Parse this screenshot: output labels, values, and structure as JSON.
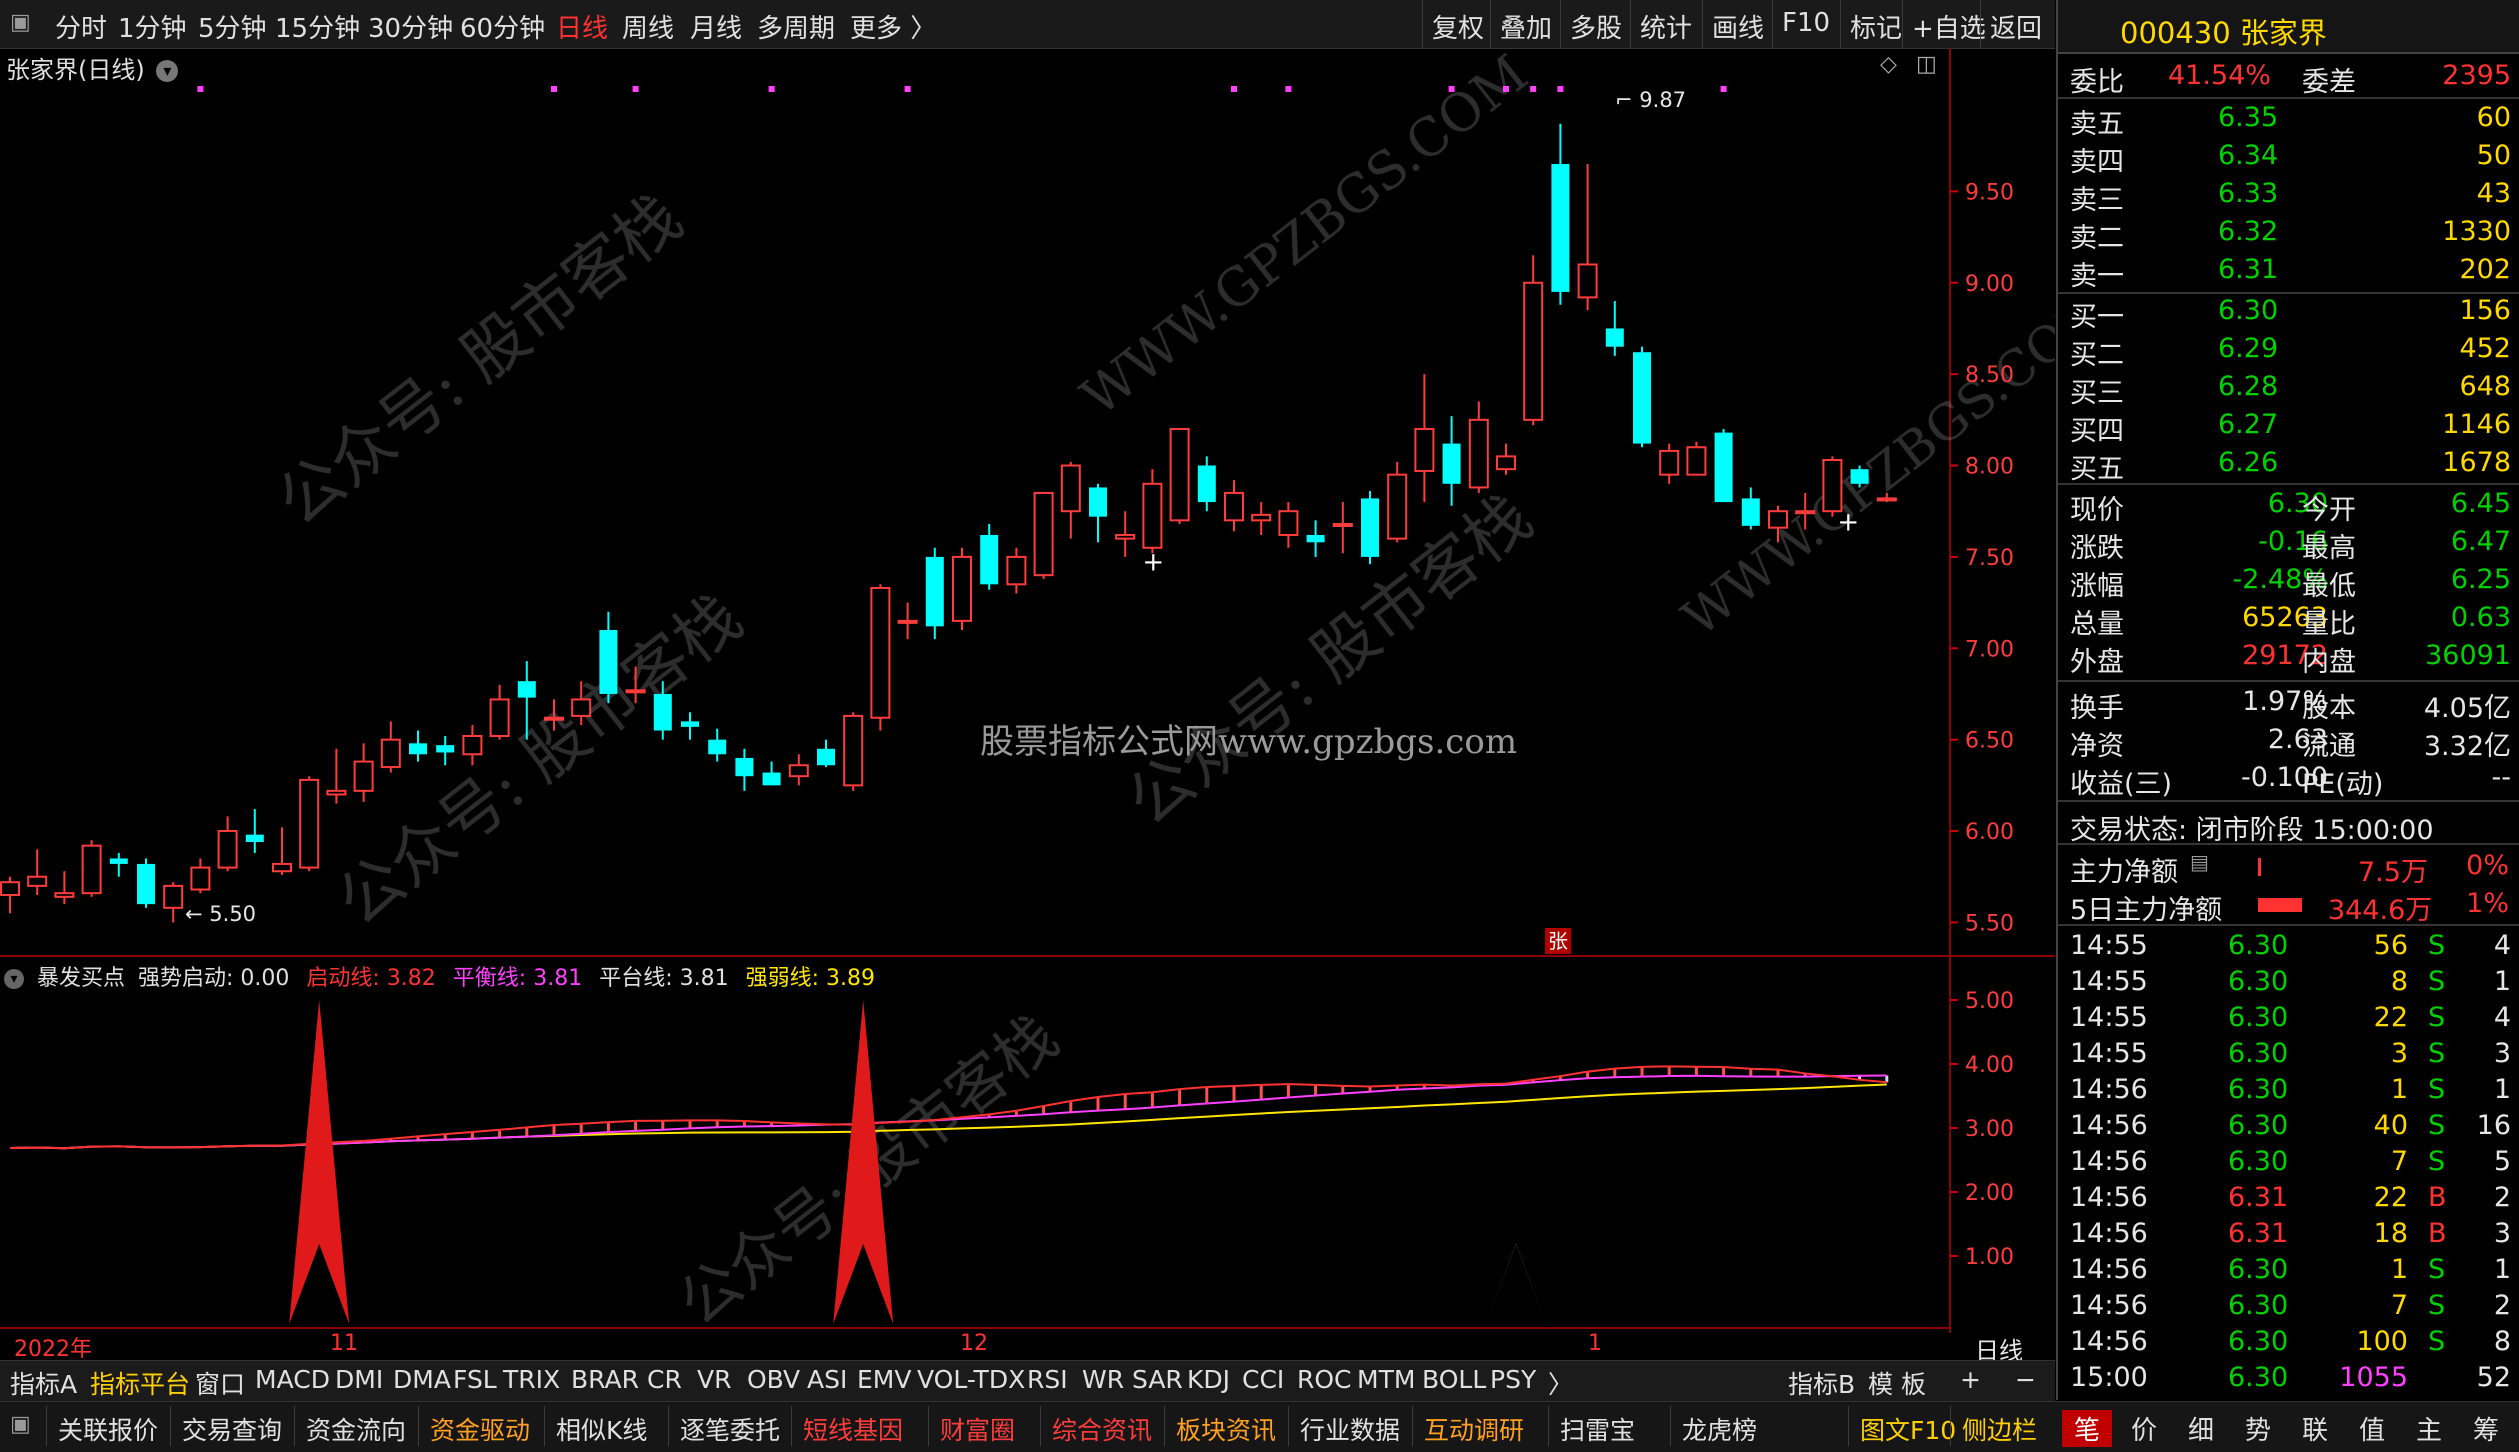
{
  "toolbar": {
    "periods": [
      "分时",
      "1分钟",
      "5分钟",
      "15分钟",
      "30分钟",
      "60分钟",
      "日线",
      "周线",
      "月线",
      "多周期",
      "更多 〉"
    ],
    "active_period": "日线",
    "right_buttons": [
      "复权",
      "叠加",
      "多股",
      "统计",
      "画线",
      "F10",
      "标记",
      "+自选",
      "返回"
    ]
  },
  "chart": {
    "title": "张家界(日线)",
    "high_label": "9.87",
    "low_label": "5.50",
    "zhang_label": "张",
    "watermark": "股票指标公式网www.gpzbgs.com",
    "price_axis": [
      "9.50",
      "9.00",
      "8.50",
      "8.00",
      "7.50",
      "7.00",
      "6.50",
      "6.00",
      "5.50"
    ],
    "ind_axis": [
      "5.00",
      "4.00",
      "3.00",
      "2.00",
      "1.00"
    ],
    "date_labels": [
      "2022年",
      "11",
      "12",
      "1"
    ],
    "period_label": "日线",
    "indicator": {
      "name": "暴发买点",
      "strong_label": "强势启动: 0.00",
      "start_label": "启动线: 3.82",
      "balance_label": "平衡线: 3.81",
      "platform_label": "平台线: 3.81",
      "weak_label": "强弱线: 3.89"
    }
  },
  "chart_data": {
    "type": "candlestick",
    "y_range": [
      5.36,
      10.0
    ],
    "candles": [
      {
        "o": 5.65,
        "h": 5.75,
        "l": 5.55,
        "c": 5.72
      },
      {
        "o": 5.7,
        "h": 5.9,
        "l": 5.65,
        "c": 5.75
      },
      {
        "o": 5.64,
        "h": 5.78,
        "l": 5.6,
        "c": 5.66
      },
      {
        "o": 5.66,
        "h": 5.95,
        "l": 5.64,
        "c": 5.92
      },
      {
        "o": 5.85,
        "h": 5.88,
        "l": 5.75,
        "c": 5.82
      },
      {
        "o": 5.82,
        "h": 5.85,
        "l": 5.58,
        "c": 5.6
      },
      {
        "o": 5.58,
        "h": 5.72,
        "l": 5.5,
        "c": 5.7
      },
      {
        "o": 5.68,
        "h": 5.85,
        "l": 5.66,
        "c": 5.8
      },
      {
        "o": 5.8,
        "h": 6.08,
        "l": 5.78,
        "c": 6.0
      },
      {
        "o": 5.98,
        "h": 6.12,
        "l": 5.88,
        "c": 5.94
      },
      {
        "o": 5.78,
        "h": 6.02,
        "l": 5.76,
        "c": 5.82
      },
      {
        "o": 5.8,
        "h": 6.3,
        "l": 5.78,
        "c": 6.28
      },
      {
        "o": 6.2,
        "h": 6.45,
        "l": 6.15,
        "c": 6.22
      },
      {
        "o": 6.22,
        "h": 6.48,
        "l": 6.16,
        "c": 6.38
      },
      {
        "o": 6.35,
        "h": 6.6,
        "l": 6.32,
        "c": 6.5
      },
      {
        "o": 6.48,
        "h": 6.55,
        "l": 6.38,
        "c": 6.42
      },
      {
        "o": 6.47,
        "h": 6.52,
        "l": 6.36,
        "c": 6.43
      },
      {
        "o": 6.42,
        "h": 6.58,
        "l": 6.36,
        "c": 6.52
      },
      {
        "o": 6.52,
        "h": 6.8,
        "l": 6.5,
        "c": 6.72
      },
      {
        "o": 6.82,
        "h": 6.93,
        "l": 6.5,
        "c": 6.73
      },
      {
        "o": 6.62,
        "h": 6.72,
        "l": 6.55,
        "c": 6.62
      },
      {
        "o": 6.63,
        "h": 6.82,
        "l": 6.58,
        "c": 6.72
      },
      {
        "o": 7.1,
        "h": 7.2,
        "l": 6.7,
        "c": 6.75
      },
      {
        "o": 6.77,
        "h": 6.9,
        "l": 6.7,
        "c": 6.77
      },
      {
        "o": 6.75,
        "h": 6.82,
        "l": 6.5,
        "c": 6.55
      },
      {
        "o": 6.6,
        "h": 6.65,
        "l": 6.5,
        "c": 6.57
      },
      {
        "o": 6.5,
        "h": 6.56,
        "l": 6.38,
        "c": 6.42
      },
      {
        "o": 6.4,
        "h": 6.45,
        "l": 6.22,
        "c": 6.3
      },
      {
        "o": 6.32,
        "h": 6.38,
        "l": 6.25,
        "c": 6.25
      },
      {
        "o": 6.3,
        "h": 6.42,
        "l": 6.25,
        "c": 6.36
      },
      {
        "o": 6.45,
        "h": 6.5,
        "l": 6.35,
        "c": 6.36
      },
      {
        "o": 6.25,
        "h": 6.65,
        "l": 6.22,
        "c": 6.63
      },
      {
        "o": 6.62,
        "h": 7.35,
        "l": 6.55,
        "c": 7.33
      },
      {
        "o": 7.15,
        "h": 7.25,
        "l": 7.05,
        "c": 7.15
      },
      {
        "o": 7.5,
        "h": 7.55,
        "l": 7.05,
        "c": 7.12
      },
      {
        "o": 7.15,
        "h": 7.55,
        "l": 7.1,
        "c": 7.5
      },
      {
        "o": 7.62,
        "h": 7.68,
        "l": 7.32,
        "c": 7.35
      },
      {
        "o": 7.35,
        "h": 7.55,
        "l": 7.3,
        "c": 7.5
      },
      {
        "o": 7.4,
        "h": 7.85,
        "l": 7.38,
        "c": 7.85
      },
      {
        "o": 7.75,
        "h": 8.02,
        "l": 7.6,
        "c": 8.0
      },
      {
        "o": 7.88,
        "h": 7.9,
        "l": 7.58,
        "c": 7.72
      },
      {
        "o": 7.6,
        "h": 7.75,
        "l": 7.5,
        "c": 7.62
      },
      {
        "o": 7.55,
        "h": 7.98,
        "l": 7.52,
        "c": 7.9
      },
      {
        "o": 7.7,
        "h": 8.2,
        "l": 7.68,
        "c": 8.2
      },
      {
        "o": 8.0,
        "h": 8.05,
        "l": 7.75,
        "c": 7.8
      },
      {
        "o": 7.7,
        "h": 7.92,
        "l": 7.64,
        "c": 7.85
      },
      {
        "o": 7.7,
        "h": 7.8,
        "l": 7.62,
        "c": 7.73
      },
      {
        "o": 7.62,
        "h": 7.8,
        "l": 7.55,
        "c": 7.75
      },
      {
        "o": 7.62,
        "h": 7.7,
        "l": 7.5,
        "c": 7.58
      },
      {
        "o": 7.68,
        "h": 7.8,
        "l": 7.52,
        "c": 7.68
      },
      {
        "o": 7.82,
        "h": 7.86,
        "l": 7.46,
        "c": 7.5
      },
      {
        "o": 7.6,
        "h": 8.02,
        "l": 7.58,
        "c": 7.95
      },
      {
        "o": 7.97,
        "h": 8.5,
        "l": 7.8,
        "c": 8.2
      },
      {
        "o": 8.12,
        "h": 8.27,
        "l": 7.78,
        "c": 7.9
      },
      {
        "o": 7.88,
        "h": 8.35,
        "l": 7.85,
        "c": 8.25
      },
      {
        "o": 7.98,
        "h": 8.12,
        "l": 7.95,
        "c": 8.05
      },
      {
        "o": 8.25,
        "h": 9.15,
        "l": 8.22,
        "c": 9.0
      },
      {
        "o": 9.65,
        "h": 9.87,
        "l": 8.88,
        "c": 8.95
      },
      {
        "o": 8.92,
        "h": 9.65,
        "l": 8.85,
        "c": 9.1
      },
      {
        "o": 8.75,
        "h": 8.9,
        "l": 8.6,
        "c": 8.65
      },
      {
        "o": 8.62,
        "h": 8.65,
        "l": 8.1,
        "c": 8.12
      },
      {
        "o": 7.95,
        "h": 8.12,
        "l": 7.9,
        "c": 8.08
      },
      {
        "o": 7.95,
        "h": 8.13,
        "l": 7.95,
        "c": 8.1
      },
      {
        "o": 8.18,
        "h": 8.2,
        "l": 7.8,
        "c": 7.8
      },
      {
        "o": 7.82,
        "h": 7.88,
        "l": 7.65,
        "c": 7.67
      },
      {
        "o": 7.66,
        "h": 7.78,
        "l": 7.58,
        "c": 7.75
      },
      {
        "o": 7.75,
        "h": 7.85,
        "l": 7.65,
        "c": 7.75
      },
      {
        "o": 7.75,
        "h": 8.05,
        "l": 7.72,
        "c": 8.03
      },
      {
        "o": 7.98,
        "h": 8.0,
        "l": 7.88,
        "c": 7.9
      },
      {
        "o": 7.82,
        "h": 7.85,
        "l": 7.8,
        "c": 7.82
      }
    ],
    "start_spikes": [
      {
        "i": 11,
        "v": 5.0,
        "color": "red"
      },
      {
        "i": 31,
        "v": 5.0,
        "color": "red"
      },
      {
        "i": 55,
        "v": 1.2,
        "color": "gray"
      }
    ],
    "ind_range": [
      0.0,
      5.5
    ]
  },
  "panel": {
    "header": "000430 张家界",
    "weibi_label": "委比",
    "weibi_value": "41.54%",
    "weicha_label": "委差",
    "weicha_value": "2395",
    "asks": [
      {
        "label": "卖五",
        "price": "6.35",
        "vol": "60"
      },
      {
        "label": "卖四",
        "price": "6.34",
        "vol": "50"
      },
      {
        "label": "卖三",
        "price": "6.33",
        "vol": "43"
      },
      {
        "label": "卖二",
        "price": "6.32",
        "vol": "1330"
      },
      {
        "label": "卖一",
        "price": "6.31",
        "vol": "202"
      }
    ],
    "bids": [
      {
        "label": "买一",
        "price": "6.30",
        "vol": "156"
      },
      {
        "label": "买二",
        "price": "6.29",
        "vol": "452"
      },
      {
        "label": "买三",
        "price": "6.28",
        "vol": "648"
      },
      {
        "label": "买四",
        "price": "6.27",
        "vol": "1146"
      },
      {
        "label": "买五",
        "price": "6.26",
        "vol": "1678"
      }
    ],
    "quote": [
      {
        "l1": "现价",
        "v1": "6.30",
        "c1": "green",
        "l2": "今开",
        "v2": "6.45",
        "c2": "green"
      },
      {
        "l1": "涨跌",
        "v1": "-0.16",
        "c1": "green",
        "l2": "最高",
        "v2": "6.47",
        "c2": "green"
      },
      {
        "l1": "涨幅",
        "v1": "-2.48%",
        "c1": "green",
        "l2": "最低",
        "v2": "6.25",
        "c2": "green"
      },
      {
        "l1": "总量",
        "v1": "65263",
        "c1": "yellow",
        "l2": "量比",
        "v2": "0.63",
        "c2": "green"
      },
      {
        "l1": "外盘",
        "v1": "29172",
        "c1": "red",
        "l2": "内盘",
        "v2": "36091",
        "c2": "green"
      }
    ],
    "fund": [
      {
        "l1": "换手",
        "v1": "1.97%",
        "l2": "股本",
        "v2": "4.05亿"
      },
      {
        "l1": "净资",
        "v1": "2.63",
        "l2": "流通",
        "v2": "3.32亿"
      },
      {
        "l1": "收益(三)",
        "v1": "-0.100",
        "l2": "PE(动)",
        "v2": "--"
      }
    ],
    "status": "交易状态: 闭市阶段 15:00:00",
    "main_net_label": "主力净额",
    "main_net_value": "7.5万",
    "main_net_pct": "0%",
    "main5_label": "5日主力净额",
    "main5_value": "344.6万",
    "main5_pct": "1%",
    "trades": [
      {
        "t": "14:55",
        "p": "6.30",
        "v": "56",
        "bs": "S",
        "n": "4"
      },
      {
        "t": "14:55",
        "p": "6.30",
        "v": "8",
        "bs": "S",
        "n": "1"
      },
      {
        "t": "14:55",
        "p": "6.30",
        "v": "22",
        "bs": "S",
        "n": "4"
      },
      {
        "t": "14:55",
        "p": "6.30",
        "v": "3",
        "bs": "S",
        "n": "3"
      },
      {
        "t": "14:56",
        "p": "6.30",
        "v": "1",
        "bs": "S",
        "n": "1"
      },
      {
        "t": "14:56",
        "p": "6.30",
        "v": "40",
        "bs": "S",
        "n": "16"
      },
      {
        "t": "14:56",
        "p": "6.30",
        "v": "7",
        "bs": "S",
        "n": "5"
      },
      {
        "t": "14:56",
        "p": "6.31",
        "v": "22",
        "bs": "B",
        "n": "2"
      },
      {
        "t": "14:56",
        "p": "6.31",
        "v": "18",
        "bs": "B",
        "n": "3"
      },
      {
        "t": "14:56",
        "p": "6.30",
        "v": "1",
        "bs": "S",
        "n": "1"
      },
      {
        "t": "14:56",
        "p": "6.30",
        "v": "7",
        "bs": "S",
        "n": "2"
      },
      {
        "t": "14:56",
        "p": "6.30",
        "v": "100",
        "bs": "S",
        "n": "8"
      },
      {
        "t": "15:00",
        "p": "6.30",
        "v": "1055",
        "bs": "",
        "n": "52"
      }
    ],
    "bottom_tabs": [
      "笔",
      "价",
      "细",
      "势",
      "联",
      "值",
      "主",
      "筹"
    ]
  },
  "indicator_tabs": [
    "指标A",
    "指标平台",
    "窗口",
    "MACD",
    "DMI",
    "DMA",
    "FSL",
    "TRIX",
    "BRAR",
    "CR",
    "VR",
    "OBV",
    "ASI",
    "EMV",
    "VOL-TDX",
    "RSI",
    "WR",
    "SAR",
    "KDJ",
    "CCI",
    "ROC",
    "MTM",
    "BOLL",
    "PSY",
    "〉"
  ],
  "indicator_tabs_right": [
    "指标B",
    "模 板",
    "+",
    "−"
  ],
  "bottom_bar": [
    {
      "label": "关联报价",
      "color": "#e0e0e0"
    },
    {
      "label": "交易查询",
      "color": "#e0e0e0"
    },
    {
      "label": "资金流向",
      "color": "#e0e0e0"
    },
    {
      "label": "资金驱动",
      "color": "#ffa020"
    },
    {
      "label": "相似K线",
      "color": "#e0e0e0"
    },
    {
      "label": "逐笔委托",
      "color": "#e0e0e0"
    },
    {
      "label": "短线基因",
      "color": "#ff3c3c"
    },
    {
      "label": "财富圈",
      "color": "#ff3c3c"
    },
    {
      "label": "综合资讯",
      "color": "#ff3c3c"
    },
    {
      "label": "板块资讯",
      "color": "#ffa020"
    },
    {
      "label": "行业数据",
      "color": "#e0e0e0"
    },
    {
      "label": "互动调研",
      "color": "#ffa020"
    },
    {
      "label": "扫雷宝",
      "color": "#e0e0e0"
    },
    {
      "label": "龙虎榜",
      "color": "#e0e0e0"
    },
    {
      "label": "图文F10",
      "color": "#ffd000"
    },
    {
      "label": "侧边栏",
      "color": "#ffd000"
    }
  ]
}
